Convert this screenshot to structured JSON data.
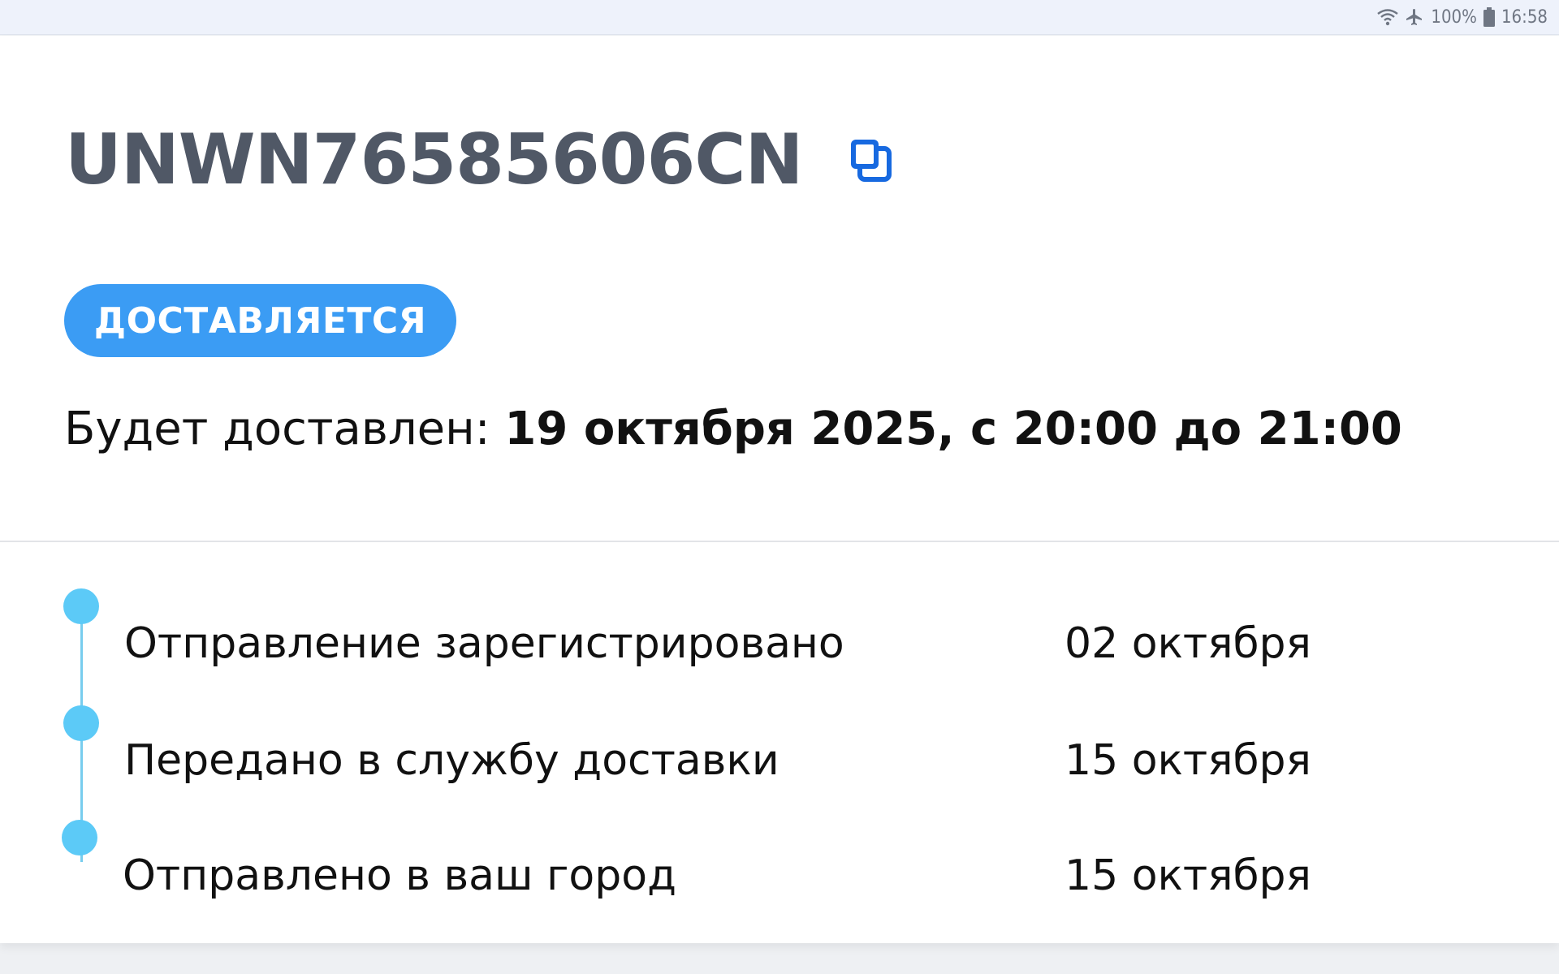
{
  "status_bar": {
    "wifi_icon": "wifi-icon",
    "airplane_icon": "airplane-mode-icon",
    "battery_percent": "100%",
    "battery_icon": "battery-icon",
    "time": "16:58"
  },
  "shipment": {
    "tracking_number": "UNWN76585606CN",
    "copy_icon": "copy-icon",
    "status_label": "ДОСТАВЛЯЕТСЯ",
    "delivery_prefix": "Будет доставлен:",
    "delivery_value": "19 октября 2025, с 20:00 до 21:00"
  },
  "timeline": [
    {
      "label": "Отправление зарегистрировано",
      "date": "02 октября"
    },
    {
      "label": "Передано в службу доставки",
      "date": "15 октября"
    },
    {
      "label": "Отправлено в ваш город",
      "date": "15 октября"
    }
  ],
  "colors": {
    "accent_blue": "#3b9cf4",
    "copy_icon_blue": "#1769e0",
    "timeline_dot": "#5ccaf7",
    "tracking_text": "#505866"
  }
}
